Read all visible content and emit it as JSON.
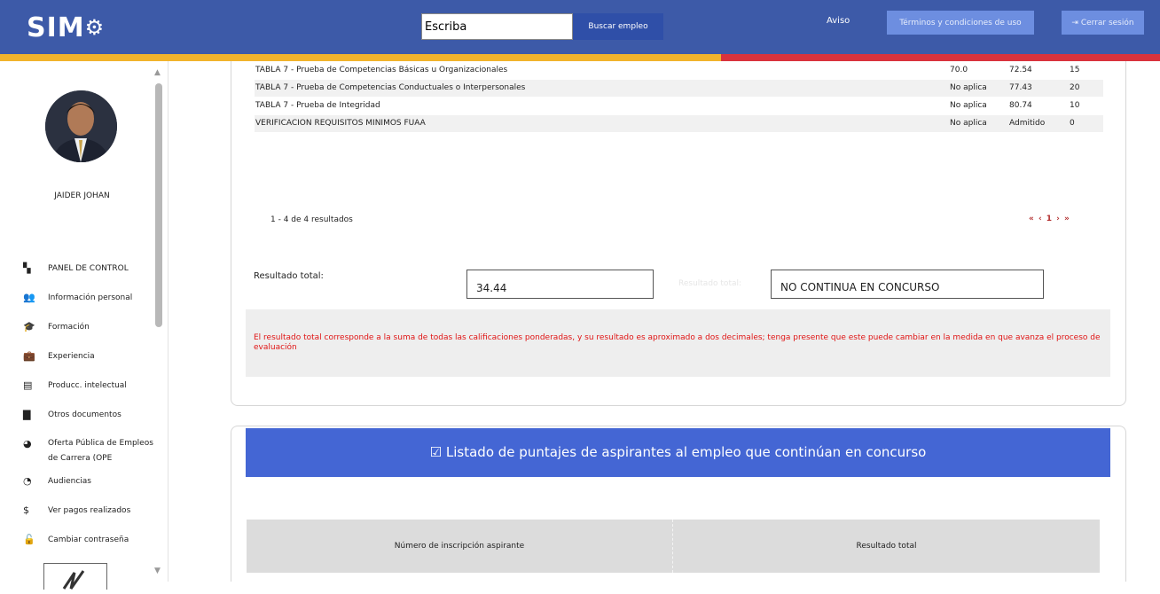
{
  "header": {
    "logo": "SIM",
    "search_value": "Escriba",
    "search_button": "Buscar empleo",
    "aviso": "Aviso",
    "terms_button": "Términos y condiciones de uso",
    "logout_button": "Cerrar sesión",
    "colors": {
      "bar": "#3d5aa8",
      "stripe_yellow": "#f1b32c",
      "stripe_red": "#d9333d"
    }
  },
  "sidebar": {
    "username": "JAIDER JOHAN",
    "items": [
      {
        "label": "PANEL DE CONTROL",
        "icon": "dashboard-icon",
        "glyph": "▚"
      },
      {
        "label": "Información personal",
        "icon": "people-icon",
        "glyph": "👥"
      },
      {
        "label": "Formación",
        "icon": "graduation-icon",
        "glyph": "🎓"
      },
      {
        "label": "Experiencia",
        "icon": "briefcase-icon",
        "glyph": "💼"
      },
      {
        "label": "Producc. intelectual",
        "icon": "book-icon",
        "glyph": "▤"
      },
      {
        "label": "Otros documentos",
        "icon": "document-icon",
        "glyph": "▇"
      },
      {
        "label": "Oferta Pública de Empleos de Carrera (OPE",
        "icon": "globe-icon",
        "glyph": "◕"
      },
      {
        "label": "Audiencias",
        "icon": "audience-icon",
        "glyph": "◔"
      },
      {
        "label": "Ver pagos realizados",
        "icon": "dollar-icon",
        "glyph": "$"
      },
      {
        "label": "Cambiar contraseña",
        "icon": "lock-icon",
        "glyph": "🔓"
      }
    ]
  },
  "results_table": {
    "rows": [
      {
        "name": "TABLA 7 - Prueba de Competencias Básicas u Organizacionales",
        "a": "70.0",
        "b": "72.54",
        "c": "15"
      },
      {
        "name": "TABLA 7 - Prueba de Competencias Conductuales o Interpersonales",
        "a": "No aplica",
        "b": "77.43",
        "c": "20"
      },
      {
        "name": "TABLA 7 - Prueba de Integridad",
        "a": "No aplica",
        "b": "80.74",
        "c": "10"
      },
      {
        "name": "VERIFICACION REQUISITOS MINIMOS FUAA",
        "a": "No aplica",
        "b": "Admitido",
        "c": "0"
      }
    ],
    "summary": "1 - 4 de 4 resultados",
    "pager": "« ‹ 1 › »"
  },
  "result": {
    "label": "Resultado total:",
    "value": "34.44",
    "label2": "Resultado total:",
    "status": "NO CONTINUA EN CONCURSO"
  },
  "note": "El resultado total corresponde a la suma de todas las calificaciones ponderadas, y su resultado es aproximado a dos decimales; tenga presente que este puede cambiar en la medida en que avanza el proceso de evaluación",
  "listing": {
    "title": "☑ Listado de puntajes de aspirantes al empleo que continúan en concurso",
    "col1": "Número de inscripción aspirante",
    "col2": "Resultado total"
  }
}
